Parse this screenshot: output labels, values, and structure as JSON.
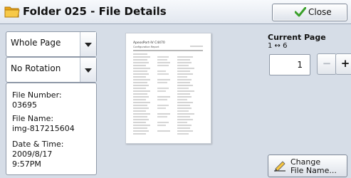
{
  "header": {
    "title": "Folder 025 - File Details",
    "close_label": "Close"
  },
  "left": {
    "page_dropdown": "Whole Page",
    "rotation_dropdown": "No Rotation"
  },
  "info": {
    "file_number_label": "File Number:",
    "file_number": "03695",
    "file_name_label": "File Name:",
    "file_name": "img-817215604",
    "date_label": "Date & Time:",
    "date": "2009/8/17",
    "time": "9:57PM"
  },
  "preview": {
    "doc_title": "ApeosPort-IV C4470",
    "doc_subtitle": "Configuration Report"
  },
  "right": {
    "current_page_label": "Current Page",
    "page_range": "1 ↔ 6",
    "page_value": "1",
    "minus_label": "−",
    "plus_label": "+",
    "change_line1": "Change",
    "change_line2": "File Name..."
  },
  "colors": {
    "background": "#d6dde7",
    "folder_icon": "#f0b429",
    "check_icon": "#3aa02a"
  }
}
